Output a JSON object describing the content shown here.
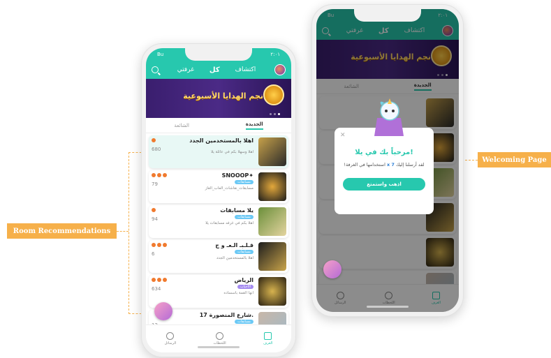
{
  "callouts": {
    "room_recommendations": "Room Recommendations",
    "welcoming_page": "Welcoming Page"
  },
  "phone1": {
    "status": {
      "time": "٢:٠١",
      "carrier": "Bu"
    },
    "nav": {
      "explore": "اكتشاف",
      "all": "كل",
      "my_room": "غرفتي"
    },
    "banner_title": "نجم الهدايا الأسبوعية",
    "subtabs": {
      "new": "الجديدة",
      "popular": "الشائعة"
    },
    "rooms": [
      {
        "name": "اهلا بالمستخدمين الجدد",
        "count": "680",
        "desc": "اهلا وسهلا بكم في عائلة يلا",
        "tag": ""
      },
      {
        "name": "SNOOOP✦",
        "count": "79",
        "desc": "مسابقات_نقاشات_العاب_الغاز",
        "tag": "مسابقات"
      },
      {
        "name": "يلا مسابقات",
        "count": "94",
        "desc": "اهلا بكم في غرفه مسابقات يلا",
        "tag": "مسابقات"
      },
      {
        "name": "قـلـبـ الـعـ و ج",
        "count": "6",
        "desc": "اهلا بالمستخدمين الجدد",
        "tag": "مسابقات"
      },
      {
        "name": "الرياض",
        "count": "634",
        "desc": "انها القمة باسساده",
        "tag": "الأحباب"
      },
      {
        "name": "شارع المنصورة 17.",
        "count": "12",
        "desc": "",
        "tag": "مسابقات"
      }
    ],
    "bottom": {
      "messages": "الرسائل",
      "moments": "اللحظات",
      "rooms": "الغرف"
    }
  },
  "phone2": {
    "status": {
      "time": "٢:٠١",
      "carrier": "Bu"
    },
    "nav": {
      "explore": "اكتشاف",
      "all": "كل",
      "my_room": "غرفتي"
    },
    "banner_title": "نجم الهدايا الأسبوعية",
    "subtabs": {
      "new": "الجديدة",
      "popular": "الشائعة"
    },
    "modal": {
      "title": "مرحباً بك في يلا!",
      "body_pre": "لقد أرسلنا إليك",
      "amount": "7 x",
      "body_post": "استخدامها في الغرفة!",
      "cta": "اذهب واستمتع"
    },
    "bottom": {
      "messages": "الرسائل",
      "moments": "اللحظات",
      "rooms": "الغرف"
    }
  }
}
